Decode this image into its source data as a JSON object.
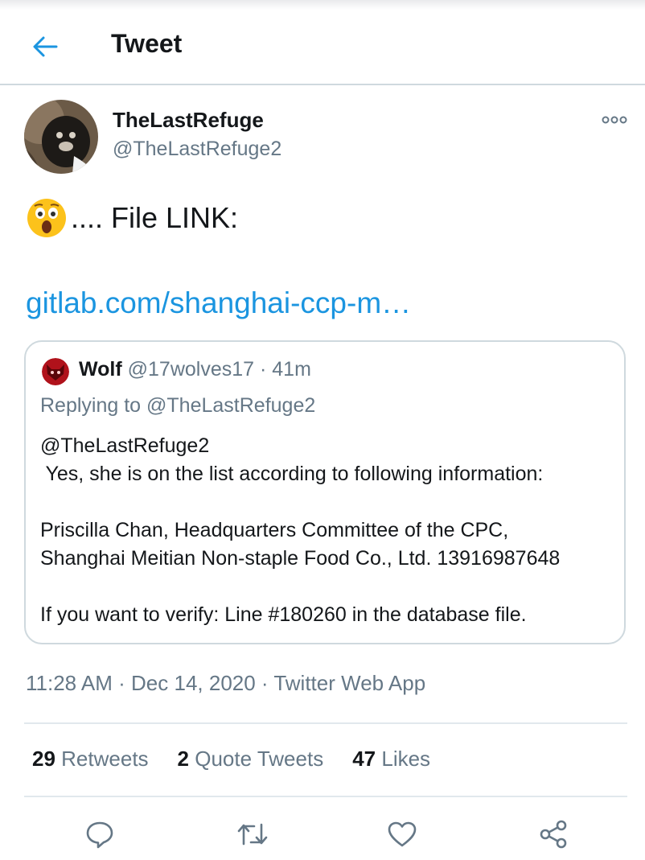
{
  "header": {
    "title": "Tweet",
    "back_icon": "arrow-left-icon"
  },
  "tweet": {
    "author": {
      "display_name": "TheLastRefuge",
      "handle": "@TheLastRefuge2"
    },
    "text": ".... File LINK:",
    "emoji": "astonished-face-emoji",
    "link": "gitlab.com/shanghai-ccp-m…",
    "timestamp": "11:28 AM · Dec 14, 2020 · Twitter Web App"
  },
  "quoted_tweet": {
    "author_name": "Wolf",
    "author_meta": "@17wolves17 · 41m",
    "replying_to": "Replying to @TheLastRefuge2",
    "body_lines": [
      "@TheLastRefuge2",
      " Yes, she is on the list according to following information:",
      "",
      "Priscilla Chan, Headquarters Committee of the CPC,",
      "Shanghai Meitian Non-staple Food Co., Ltd. 13916987648",
      "",
      "If you want to verify: Line #180260 in the database file."
    ]
  },
  "stats": {
    "retweets": {
      "count": "29",
      "label": "Retweets"
    },
    "quotes": {
      "count": "2",
      "label": "Quote Tweets"
    },
    "likes": {
      "count": "47",
      "label": "Likes"
    }
  },
  "actions": [
    "reply-icon",
    "retweet-icon",
    "like-icon",
    "share-icon"
  ],
  "colors": {
    "accent": "#1b95e0",
    "text": "#14171a",
    "secondary": "#657786",
    "border": "#cfd9de"
  }
}
